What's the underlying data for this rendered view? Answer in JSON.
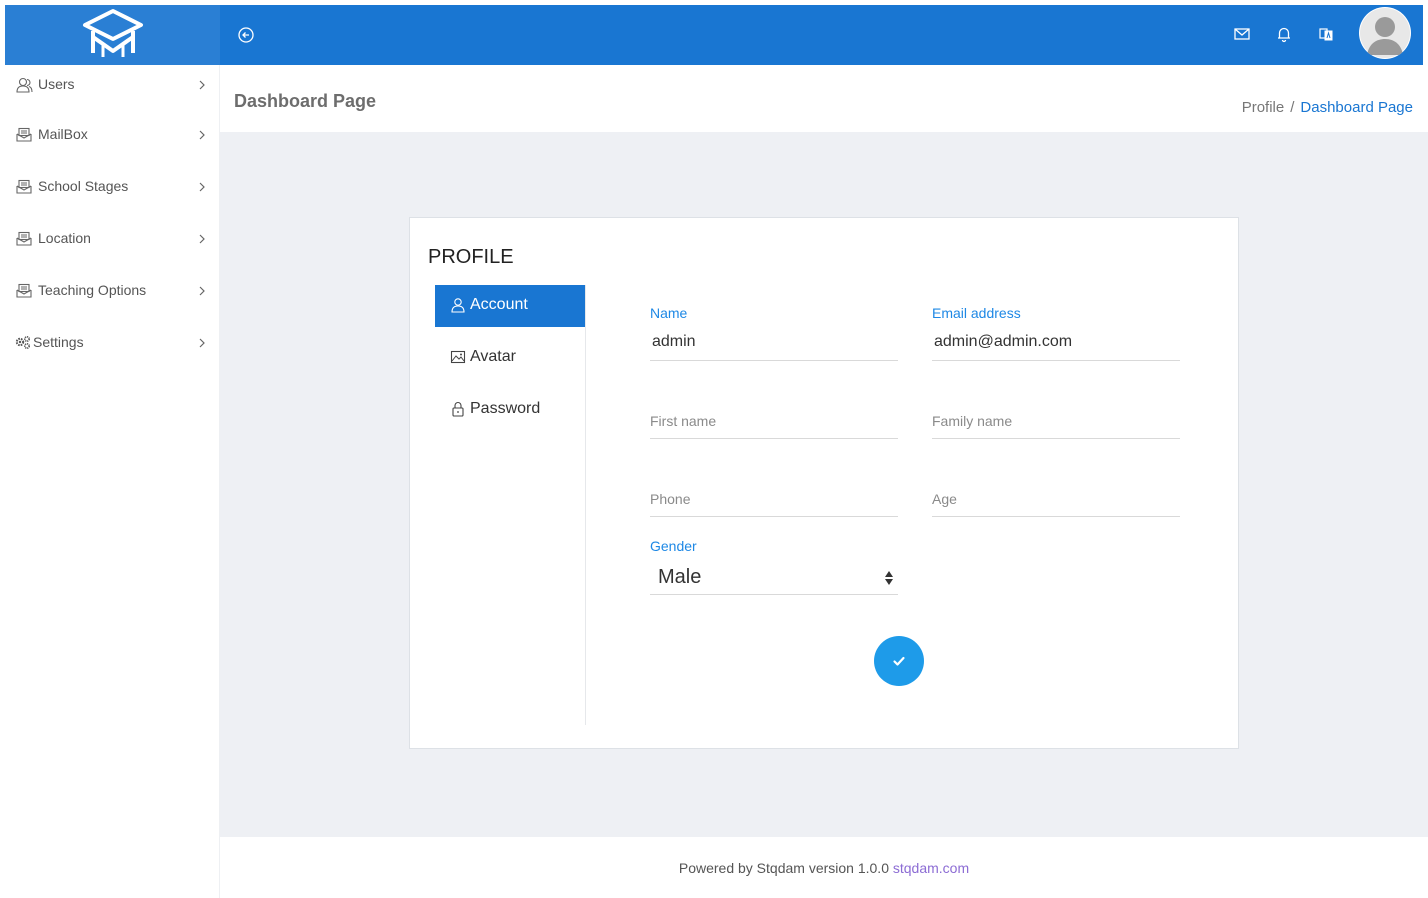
{
  "topbar": {
    "logo_icon": "graduation-cap-logo-icon",
    "collapse_icon": "arrow-left-circle-icon",
    "mail_icon": "mail-icon",
    "bell_icon": "bell-icon",
    "language_icon": "translate-icon",
    "avatar_icon": "user-avatar-icon",
    "color": "#1976d2"
  },
  "sidebar": {
    "items": [
      {
        "label": "Users",
        "icon": "users-icon"
      },
      {
        "label": "MailBox",
        "icon": "mailbox-icon"
      },
      {
        "label": "School Stages",
        "icon": "mailbox-icon"
      },
      {
        "label": "Location",
        "icon": "mailbox-icon"
      },
      {
        "label": "Teaching Options",
        "icon": "mailbox-icon"
      },
      {
        "label": "Settings",
        "icon": "gears-icon"
      }
    ]
  },
  "header": {
    "title": "Dashboard Page",
    "breadcrumb": [
      "Profile",
      "Dashboard Page"
    ],
    "breadcrumb_sep": "/"
  },
  "profile": {
    "title": "PROFILE",
    "tabs": [
      {
        "label": "Account",
        "icon": "user-icon",
        "active": true
      },
      {
        "label": "Avatar",
        "icon": "image-icon",
        "active": false
      },
      {
        "label": "Password",
        "icon": "lock-icon",
        "active": false
      }
    ],
    "fields": {
      "name": {
        "label": "Name",
        "value": "admin"
      },
      "email": {
        "label": "Email address",
        "value": "admin@admin.com"
      },
      "first_name": {
        "label": "First name",
        "value": ""
      },
      "family_name": {
        "label": "Family name",
        "value": ""
      },
      "phone": {
        "label": "Phone",
        "value": ""
      },
      "age": {
        "label": "Age",
        "value": ""
      },
      "gender": {
        "label": "Gender",
        "value": "Male"
      }
    },
    "submit_icon": "check-icon"
  },
  "footer": {
    "text": "Powered by Stqdam version 1.0.0",
    "link": "stqdam.com"
  }
}
